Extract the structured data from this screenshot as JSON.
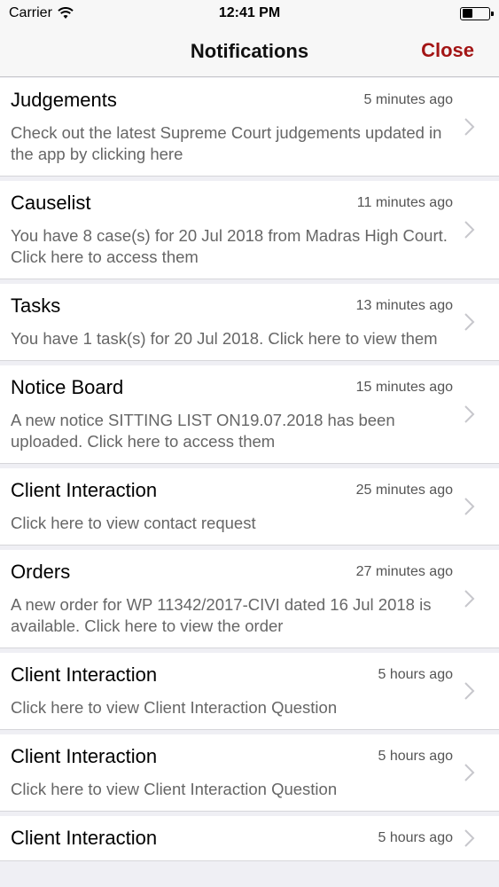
{
  "status": {
    "carrier": "Carrier",
    "time": "12:41 PM"
  },
  "header": {
    "title": "Notifications",
    "close_label": "Close"
  },
  "notifications": [
    {
      "title": "Judgements",
      "time": "5 minutes ago",
      "message": "Check out the latest Supreme Court judgements updated in the app by clicking here"
    },
    {
      "title": "Causelist",
      "time": "11 minutes ago",
      "message": "You have 8 case(s)  for 20 Jul 2018 from Madras High Court. Click here to access them"
    },
    {
      "title": "Tasks",
      "time": "13 minutes ago",
      "message": "You have 1 task(s) for 20 Jul 2018. Click here to view them"
    },
    {
      "title": "Notice Board",
      "time": "15 minutes ago",
      "message": "A new notice SITTING LIST ON19.07.2018 has been uploaded. Click here to access them"
    },
    {
      "title": "Client Interaction",
      "time": "25 minutes ago",
      "message": "Click here to view contact request"
    },
    {
      "title": "Orders",
      "time": "27 minutes ago",
      "message": "A new order for WP 11342/2017-CIVI dated 16 Jul 2018 is available. Click here to view the order"
    },
    {
      "title": "Client Interaction",
      "time": "5 hours ago",
      "message": "Click here to view Client Interaction Question"
    },
    {
      "title": "Client Interaction",
      "time": "5 hours ago",
      "message": "Click here to view Client Interaction Question"
    },
    {
      "title": "Client Interaction",
      "time": "5 hours ago",
      "message": ""
    }
  ],
  "colors": {
    "accent": "#a31515",
    "background": "#efeff4"
  }
}
